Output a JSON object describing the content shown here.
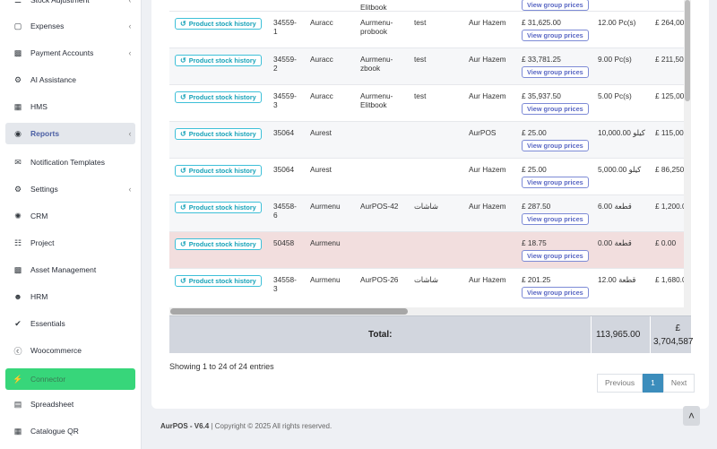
{
  "sidebar": {
    "items": [
      {
        "label": "Stock Adjustment",
        "icon": "stock-adjust-icon",
        "chevron": true
      },
      {
        "label": "Expenses",
        "icon": "expenses-icon",
        "chevron": true
      },
      {
        "label": "Payment Accounts",
        "icon": "payment-accounts-icon",
        "chevron": true
      },
      {
        "label": "AI Assistance",
        "icon": "robot-icon",
        "chevron": false
      },
      {
        "label": "HMS",
        "icon": "building-icon",
        "chevron": false
      },
      {
        "label": "Reports",
        "icon": "reports-icon",
        "chevron": true
      },
      {
        "label": "Notification Templates",
        "icon": "envelope-icon",
        "chevron": false
      },
      {
        "label": "Settings",
        "icon": "gear-icon",
        "chevron": true
      },
      {
        "label": "CRM",
        "icon": "broadcast-icon",
        "chevron": false
      },
      {
        "label": "Project",
        "icon": "project-icon",
        "chevron": false
      },
      {
        "label": "Asset Management",
        "icon": "boxes-icon",
        "chevron": false
      },
      {
        "label": "HRM",
        "icon": "users-icon",
        "chevron": false
      },
      {
        "label": "Essentials",
        "icon": "check-circle-icon",
        "chevron": false
      },
      {
        "label": "Woocommerce",
        "icon": "wordpress-icon",
        "chevron": false
      },
      {
        "label": "Connector",
        "icon": "plug-icon",
        "chevron": false
      },
      {
        "label": "Spreadsheet",
        "icon": "file-icon",
        "chevron": false
      },
      {
        "label": "Catalogue QR",
        "icon": "qrcode-icon",
        "chevron": false
      }
    ]
  },
  "table": {
    "history_label": "Product stock history",
    "group_label": "View group prices",
    "partial_top": {
      "c3": "Elitbook"
    },
    "rows": [
      {
        "sku": "34559-1",
        "business": "Auracc",
        "product": "Aurmenu-probook",
        "variation": "test",
        "location": "Aur Hazem",
        "price": "£ 31,625.00",
        "qty": "12.00 Pc(s)",
        "value": "£ 264,00",
        "style": "odd"
      },
      {
        "sku": "34559-2",
        "business": "Auracc",
        "product": "Aurmenu-zbook",
        "variation": "test",
        "location": "Aur Hazem",
        "price": "£ 33,781.25",
        "qty": "9.00 Pc(s)",
        "value": "£ 211,50",
        "style": "even"
      },
      {
        "sku": "34559-3",
        "business": "Auracc",
        "product": "Aurmenu-Elitbook",
        "variation": "test",
        "location": "Aur Hazem",
        "price": "£ 35,937.50",
        "qty": "5.00 Pc(s)",
        "value": "£ 125,00",
        "style": "odd"
      },
      {
        "sku": "35064",
        "business": "Aurest",
        "product": "",
        "variation": "",
        "location": "AurPOS",
        "price": "£ 25.00",
        "qty": "10,000.00 كيلو",
        "value": "£ 115,00",
        "style": "even"
      },
      {
        "sku": "35064",
        "business": "Aurest",
        "product": "",
        "variation": "",
        "location": "Aur Hazem",
        "price": "£ 25.00",
        "qty": "5,000.00 كيلو",
        "value": "£ 86,250",
        "style": "odd"
      },
      {
        "sku": "34558-6",
        "business": "Aurmenu",
        "product": "AurPOS-42",
        "variation": "شاشات",
        "location": "Aur Hazem",
        "price": "£ 287.50",
        "qty": "6.00 قطعة",
        "value": "£ 1,200.0",
        "style": "even"
      },
      {
        "sku": "50458",
        "business": "Aurmenu",
        "product": "",
        "variation": "",
        "location": "",
        "price": "£ 18.75",
        "qty": "0.00 قطعة",
        "value": "£ 0.00",
        "style": "danger"
      },
      {
        "sku": "34558-3",
        "business": "Aurmenu",
        "product": "AurPOS-26",
        "variation": "شاشات",
        "location": "Aur Hazem",
        "price": "£ 201.25",
        "qty": "12.00 قطعة",
        "value": "£ 1,680.0",
        "style": "odd"
      }
    ]
  },
  "totals": {
    "label": "Total:",
    "qty": "113,965.00",
    "value_line1": "£",
    "value_line2": "3,704,587"
  },
  "showing": "Showing 1 to 24 of 24 entries",
  "pagination": {
    "previous": "Previous",
    "current": "1",
    "next": "Next"
  },
  "footer": {
    "brand": "AurPOS - V6.4",
    "text": " | Copyright © 2025 All rights reserved."
  },
  "colors": {
    "accent": "#3c8dbc",
    "active_green": "#37d67a",
    "danger_row": "#f2dede",
    "info": "#17a2b8"
  }
}
